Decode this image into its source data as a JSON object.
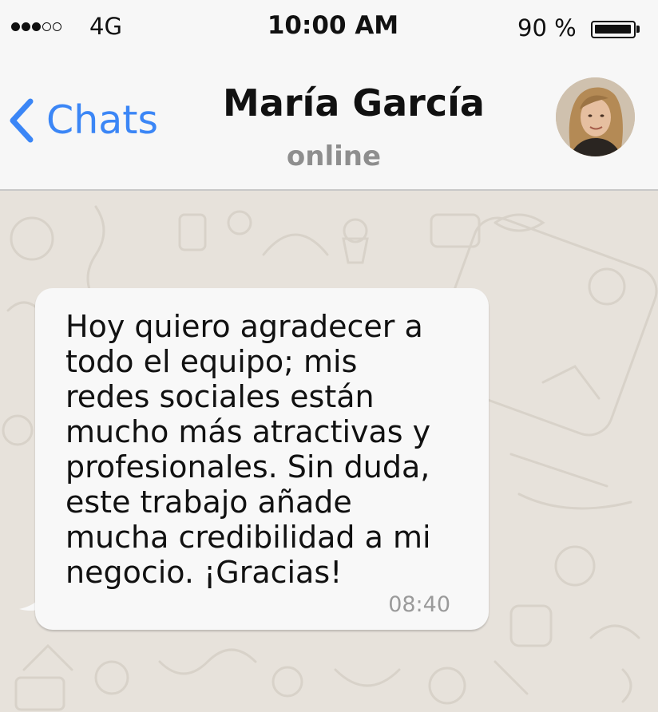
{
  "status_bar": {
    "signal_dots": [
      true,
      true,
      true,
      false,
      false
    ],
    "network": "4G",
    "time": "10:00 AM",
    "battery_percent": "90 %",
    "battery_level": 0.9
  },
  "header": {
    "back_label": "Chats",
    "back_icon": "chevron-left-icon",
    "contact_name": "María García",
    "contact_status": "online",
    "avatar_icon": "profile-photo"
  },
  "messages": [
    {
      "direction": "incoming",
      "text": "Hoy quiero agradecer a\ntodo el equipo; mis\nredes sociales están\nmucho más atractivas y\nprofesionales. Sin duda,\neste trabajo añade\nmucha credibilidad a mi\nnegocio. ¡Gracias!",
      "time": "08:40"
    }
  ],
  "colors": {
    "accent": "#3b86f6",
    "header_bg": "#f7f7f7",
    "chat_bg": "#e7e2db",
    "bubble_bg": "#f8f8f8",
    "muted_text": "#8e8e8e"
  }
}
